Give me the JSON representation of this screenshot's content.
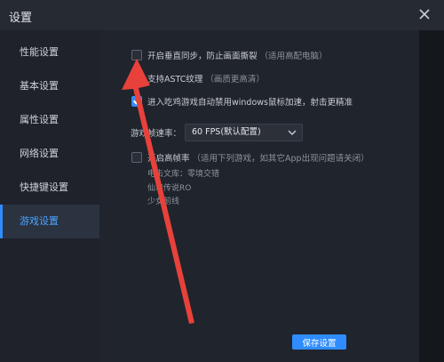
{
  "window": {
    "title": "设置"
  },
  "sidebar": {
    "items": [
      {
        "label": "性能设置"
      },
      {
        "label": "基本设置"
      },
      {
        "label": "属性设置"
      },
      {
        "label": "网络设置"
      },
      {
        "label": "快捷键设置"
      },
      {
        "label": "游戏设置",
        "active": true
      }
    ]
  },
  "game_settings": {
    "vsync": {
      "checked": false,
      "label": "开启垂直同步，防止画面撕裂",
      "note": "（适用高配电脑）"
    },
    "astc": {
      "checked": true,
      "label": "支持ASTC纹理",
      "note": "（画质更高清）"
    },
    "mouse_accel": {
      "checked": true,
      "label": "进入吃鸡游戏自动禁用windows鼠标加速，射击更精准"
    },
    "fps": {
      "label": "游戏帧速率：",
      "selected": "60 FPS(默认配置)"
    },
    "high_frame": {
      "checked": false,
      "label": "开启高帧率",
      "note": "（适用下列游戏，如其它App出现问题请关闭）",
      "games": [
        "电击文库：零境交错",
        "仙境传说RO",
        "少女前线"
      ]
    }
  },
  "actions": {
    "save_label": "保存设置"
  },
  "colors": {
    "accent": "#2f8cff",
    "arrow": "#e8413b",
    "background": "#20242c"
  }
}
